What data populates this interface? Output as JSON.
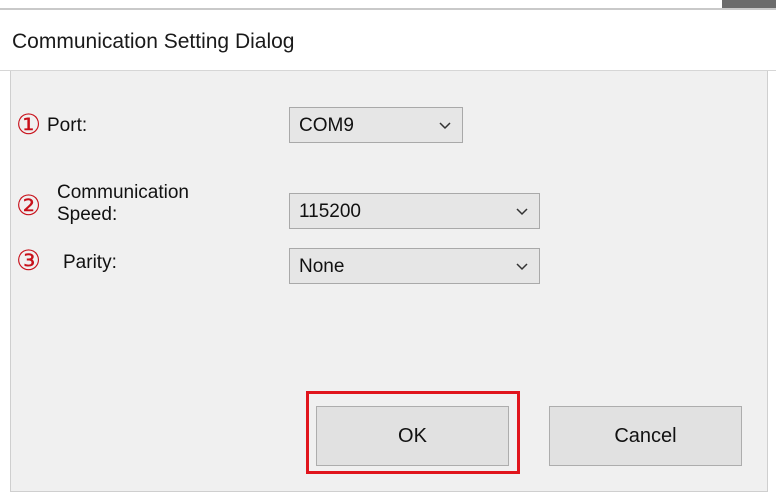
{
  "window": {
    "title": "Communication Setting Dialog"
  },
  "form": {
    "port": {
      "marker": "①",
      "label": "Port:",
      "selected": "COM9"
    },
    "speed": {
      "marker": "②",
      "label_line1": "Communication",
      "label_line2": "Speed:",
      "selected": "115200"
    },
    "parity": {
      "marker": "③",
      "label": "Parity:",
      "selected": "None"
    }
  },
  "buttons": {
    "ok_label": "OK",
    "cancel_label": "Cancel"
  },
  "colors": {
    "marker_red": "#c8101a",
    "highlight_red": "#e0141c",
    "dialog_background": "#f0f0f0",
    "combo_background": "#e6e6e6",
    "button_background": "#e1e1e1"
  },
  "icons": {
    "dropdown": "chevron-down-icon"
  }
}
